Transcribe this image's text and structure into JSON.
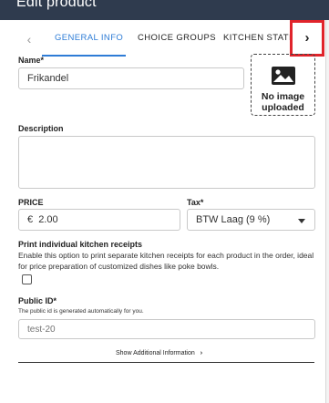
{
  "window": {
    "title": "Edit product"
  },
  "tabs": {
    "items": [
      "GENERAL INFO",
      "CHOICE GROUPS",
      "KITCHEN STATIONS"
    ],
    "prev_icon": "chevron-left",
    "next_icon": "chevron-right",
    "prev_glyph": "‹",
    "next_glyph": "›"
  },
  "form": {
    "name": {
      "label": "Name*",
      "value": "Frikandel"
    },
    "image": {
      "placeholder_text": "No image uploaded",
      "icon": "image-icon"
    },
    "description": {
      "label": "Description",
      "value": ""
    },
    "price": {
      "label": "PRICE",
      "currency": "€",
      "value": "2.00"
    },
    "tax": {
      "label": "Tax*",
      "value": "BTW Laag (9 %)"
    },
    "kitchen_receipts": {
      "title": "Print individual kitchen receipts",
      "description": "Enable this option to print separate kitchen receipts for each product in the order, ideal for price preparation of customized dishes like poke bowls.",
      "checked": false
    },
    "public_id": {
      "label": "Public ID*",
      "hint": "The public id is generated automatically for you.",
      "placeholder": "test-20"
    },
    "show_more": {
      "label": "Show Additional Information",
      "glyph": "›"
    }
  },
  "colors": {
    "header_bg": "#2f3b4e",
    "accent": "#2e7cd6",
    "highlight_border": "#e0242b"
  }
}
